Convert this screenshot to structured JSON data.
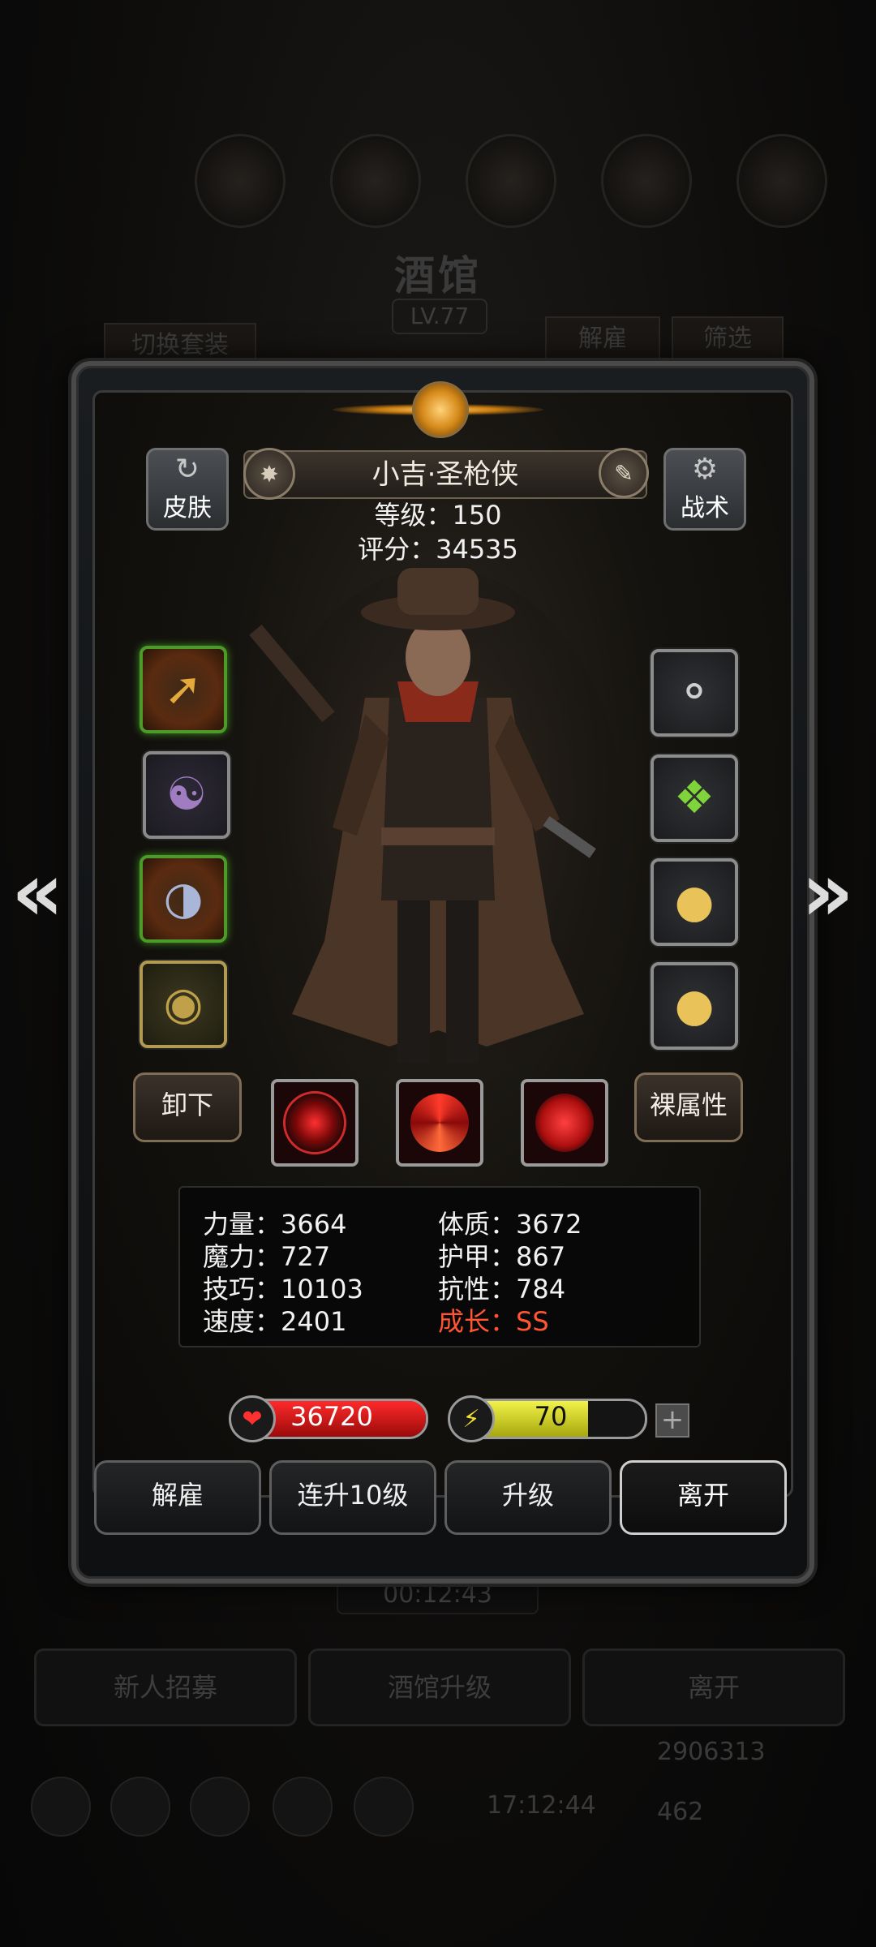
{
  "background": {
    "title": "酒馆",
    "level": "LV.77",
    "switch_outfit": "切换套装",
    "dismiss": "解雇",
    "filter": "筛选",
    "timer": "00:12:43",
    "buttons": [
      "新人招募",
      "酒馆升级",
      "离开"
    ],
    "clock": "17:12:44",
    "gold": "2906313",
    "gems": "462"
  },
  "hero": {
    "name": "小吉·圣枪侠",
    "level_line": "等级：150",
    "score_line": "评分：34535",
    "skin_label": "皮肤",
    "tactics_label": "战术"
  },
  "equipment": {
    "left": [
      "golden-rifle",
      "coat-armor",
      "helmet",
      "gold-medallion"
    ],
    "right": [
      "amulet-ring",
      "green-gem",
      "lantern-charm",
      "lantern-charm"
    ]
  },
  "controls": {
    "unequip": "卸下",
    "base_attrs": "裸属性"
  },
  "stats": {
    "strength": "力量：3664",
    "constitution": "体质：3672",
    "magic": "魔力：727",
    "armor": "护甲：867",
    "skill": "技巧：10103",
    "resist": "抗性：784",
    "speed": "速度：2401",
    "growth": "成长：SS"
  },
  "bars": {
    "hp_value": "36720",
    "hp_fraction": 1.0,
    "energy_value": "70",
    "energy_fraction": 0.7,
    "plus": "+"
  },
  "actions": {
    "dismiss": "解雇",
    "level_up_10": "连升10级",
    "level_up": "升级",
    "leave": "离开"
  },
  "colors": {
    "hp": "#d81818",
    "energy": "#d8d81a",
    "growth": "#ff5533"
  }
}
